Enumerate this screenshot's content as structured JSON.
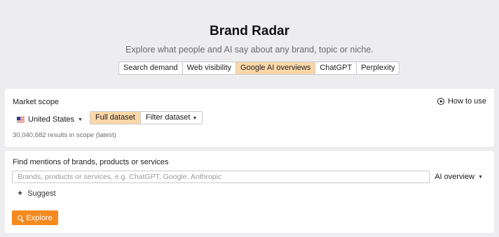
{
  "header": {
    "title": "Brand Radar",
    "subtitle": "Explore what people and AI say about any brand, topic or niche."
  },
  "tabs": [
    {
      "label": "Search demand",
      "active": false
    },
    {
      "label": "Web visibility",
      "active": false
    },
    {
      "label": "Google AI overviews",
      "active": true
    },
    {
      "label": "ChatGPT",
      "active": false
    },
    {
      "label": "Perplexity",
      "active": false
    }
  ],
  "market": {
    "label": "Market scope",
    "how_to_use": "How to use",
    "country": "United States",
    "dataset_options": [
      "Full dataset",
      "Filter dataset"
    ],
    "results": "30,040,682 results in scope (latest)"
  },
  "mentions": {
    "label": "Find mentions of brands, products or services",
    "placeholder": "Brands, products or services, e.g. ChatGPT, Google, Anthropic",
    "source_select": "AI overview",
    "suggest": "Suggest",
    "explore": "Explore"
  },
  "colors": {
    "accent": "#f58a1f",
    "active_tab": "#fbd7a8",
    "background": "#ededef"
  },
  "icons": {
    "how_to_use": "play-circle-icon",
    "flag": "us-flag-icon",
    "suggest": "sparkle-icon",
    "explore": "search-icon"
  }
}
